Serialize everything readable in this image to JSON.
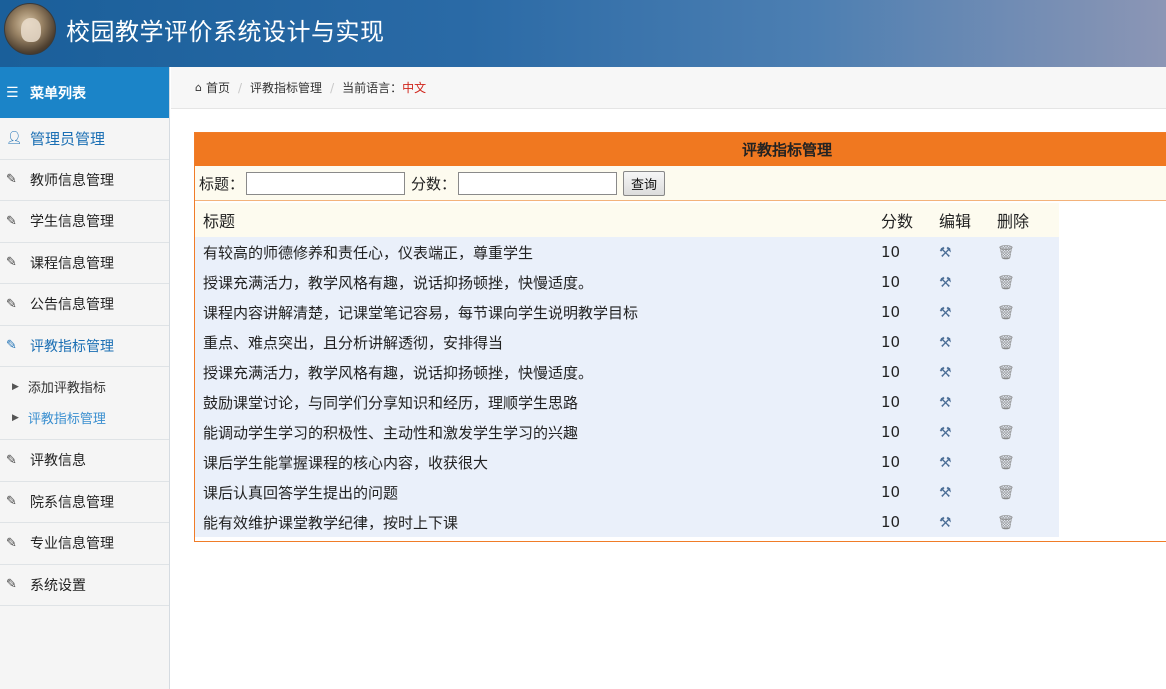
{
  "app": {
    "title": "校园教学评价系统设计与实现"
  },
  "sidebar": {
    "header_label": "菜单列表",
    "items": [
      {
        "label": "管理员管理",
        "icon": "user-icon"
      },
      {
        "label": "教师信息管理",
        "icon": "edit-icon"
      },
      {
        "label": "学生信息管理",
        "icon": "edit-icon"
      },
      {
        "label": "课程信息管理",
        "icon": "edit-icon"
      },
      {
        "label": "公告信息管理",
        "icon": "edit-icon"
      },
      {
        "label": "评教指标管理",
        "icon": "edit-icon"
      },
      {
        "label": "评教信息",
        "icon": "edit-icon"
      },
      {
        "label": "院系信息管理",
        "icon": "edit-icon"
      },
      {
        "label": "专业信息管理",
        "icon": "edit-icon"
      },
      {
        "label": "系统设置",
        "icon": "edit-icon"
      }
    ],
    "sub_items": [
      {
        "label": "添加评教指标"
      },
      {
        "label": "评教指标管理"
      }
    ]
  },
  "breadcrumb": {
    "home": "首页",
    "current": "评教指标管理",
    "lang_label": "当前语言：",
    "lang_value": "中文"
  },
  "panel": {
    "title": "评教指标管理",
    "search": {
      "title_label": "标题：",
      "title_value": "",
      "score_label": "分数：",
      "score_value": "",
      "button": "查询"
    },
    "columns": {
      "title": "标题",
      "score": "分数",
      "edit": "编辑",
      "delete": "删除"
    },
    "rows": [
      {
        "title": "有较高的师德修养和责任心，仪表端正，尊重学生",
        "score": "10"
      },
      {
        "title": "授课充满活力，教学风格有趣，说话抑扬顿挫，快慢适度。",
        "score": "10"
      },
      {
        "title": "课程内容讲解清楚，记课堂笔记容易，每节课向学生说明教学目标",
        "score": "10"
      },
      {
        "title": "重点、难点突出，且分析讲解透彻，安排得当",
        "score": "10"
      },
      {
        "title": "授课充满活力，教学风格有趣，说话抑扬顿挫，快慢适度。",
        "score": "10"
      },
      {
        "title": "鼓励课堂讨论，与同学们分享知识和经历，理顺学生思路",
        "score": "10"
      },
      {
        "title": "能调动学生学习的积极性、主动性和激发学生学习的兴趣",
        "score": "10"
      },
      {
        "title": "课后学生能掌握课程的核心内容，收获很大",
        "score": "10"
      },
      {
        "title": "课后认真回答学生提出的问题",
        "score": "10"
      },
      {
        "title": "能有效维护课堂教学纪律，按时上下课",
        "score": "10"
      }
    ]
  },
  "colors": {
    "header_blue": "#1a5f9a",
    "menu_active_blue": "#1b84c8",
    "panel_orange": "#f07820",
    "row_bg": "#eaf0fa",
    "lang_red": "#d0261c"
  }
}
